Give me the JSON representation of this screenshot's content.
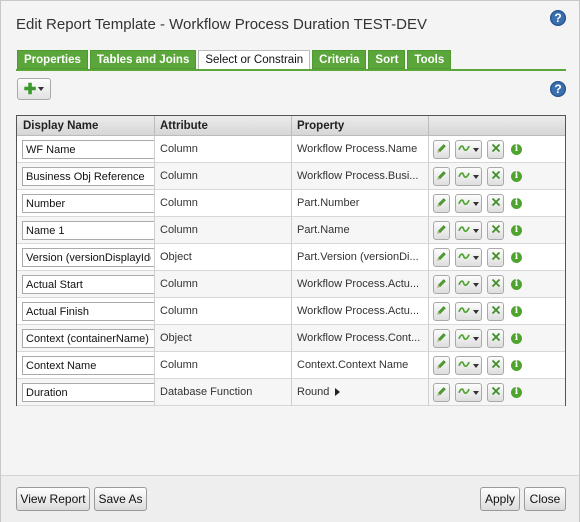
{
  "dialog": {
    "title": "Edit Report Template - Workflow Process Duration TEST-DEV",
    "help_glyph": "?"
  },
  "tabs": [
    {
      "label": "Properties",
      "active": false
    },
    {
      "label": "Tables and Joins",
      "active": false
    },
    {
      "label": "Select or Constrain",
      "active": true
    },
    {
      "label": "Criteria",
      "active": false
    },
    {
      "label": "Sort",
      "active": false
    },
    {
      "label": "Tools",
      "active": false
    }
  ],
  "toolbar": {
    "add_icon": "plus-icon"
  },
  "grid": {
    "headers": {
      "display_name": "Display Name",
      "attribute": "Attribute",
      "property": "Property"
    },
    "rows": [
      {
        "display_name": "WF Name",
        "attribute": "Column",
        "property": "Workflow Process.Name"
      },
      {
        "display_name": "Business Obj Reference",
        "attribute": "Column",
        "property": "Workflow Process.Busi..."
      },
      {
        "display_name": "Number",
        "attribute": "Column",
        "property": "Part.Number"
      },
      {
        "display_name": "Name 1",
        "attribute": "Column",
        "property": "Part.Name"
      },
      {
        "display_name": "Version (versionDisplayIde",
        "attribute": "Object",
        "property": "Part.Version (versionDi..."
      },
      {
        "display_name": "Actual Start",
        "attribute": "Column",
        "property": "Workflow Process.Actu..."
      },
      {
        "display_name": "Actual Finish",
        "attribute": "Column",
        "property": "Workflow Process.Actu..."
      },
      {
        "display_name": "Context (containerName)",
        "attribute": "Object",
        "property": "Workflow Process.Cont..."
      },
      {
        "display_name": "Context Name",
        "attribute": "Column",
        "property": "Context.Context Name"
      },
      {
        "display_name": "Duration",
        "attribute": "Database Function",
        "property": "Round",
        "has_submenu": true
      }
    ]
  },
  "footer": {
    "view_report": "View Report",
    "save_as": "Save As",
    "apply": "Apply",
    "close": "Close"
  },
  "colors": {
    "accent_green": "#5aa63a",
    "help_blue": "#3a6fb0"
  }
}
